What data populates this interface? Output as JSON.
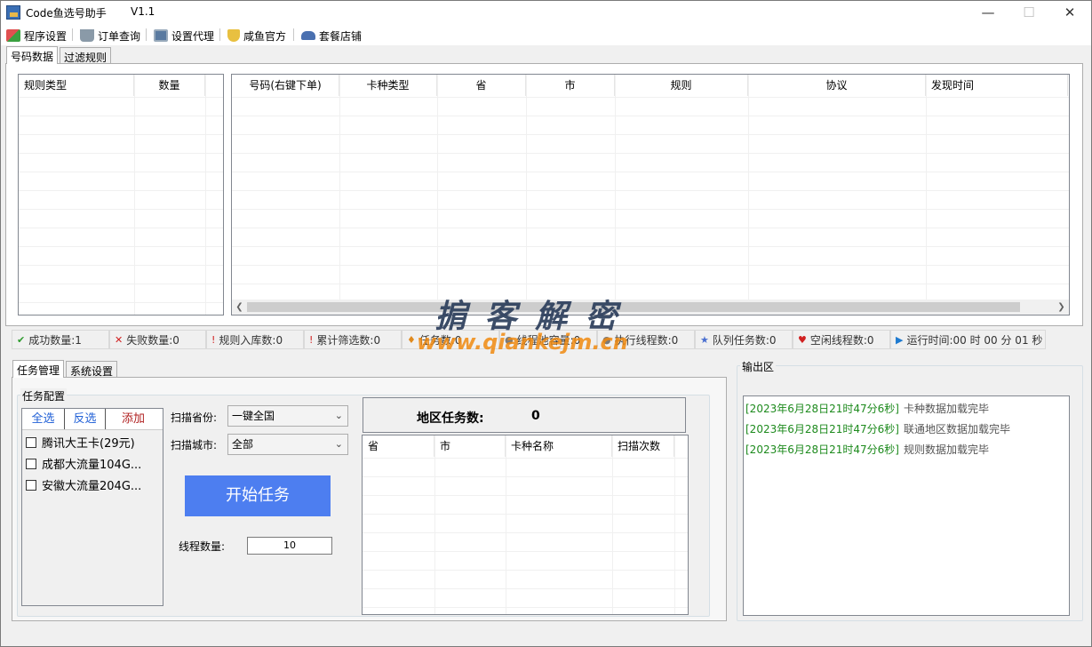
{
  "window": {
    "title": "Code鱼选号助手",
    "version": "V1.1",
    "minimize": "—",
    "maximize": "☐",
    "close": "✕"
  },
  "menu": [
    {
      "label": "程序设置",
      "icon": "settings-icon"
    },
    {
      "label": "订单查询",
      "icon": "cart-icon"
    },
    {
      "label": "设置代理",
      "icon": "computer-icon"
    },
    {
      "label": "咸鱼官方",
      "icon": "shield-icon"
    },
    {
      "label": "套餐店铺",
      "icon": "car-icon"
    }
  ],
  "top_tabs": [
    "号码数据",
    "过滤规则"
  ],
  "rule_table": {
    "columns": [
      "规则类型",
      "数量"
    ]
  },
  "number_table": {
    "columns": [
      "号码(右键下单)",
      "卡种类型",
      "省",
      "市",
      "规则",
      "协议",
      "发现时间"
    ]
  },
  "status_bar": [
    {
      "icon": "✔",
      "color": "#2e9b2e",
      "text": "成功数量:1"
    },
    {
      "icon": "✕",
      "color": "#d02020",
      "text": "失败数量:0"
    },
    {
      "icon": "!",
      "color": "#d02020",
      "text": "规则入库数:0"
    },
    {
      "icon": "!",
      "color": "#d02020",
      "text": "累计筛选数:0"
    },
    {
      "icon": "♦",
      "color": "#e08a1e",
      "text": "任务数:0"
    },
    {
      "icon": "●",
      "color": "#7a7a7a",
      "text": "线程池容量:0"
    },
    {
      "icon": "●",
      "color": "#7a7a7a",
      "text": "执行线程数:0"
    },
    {
      "icon": "★",
      "color": "#4a6fd0",
      "text": "队列任务数:0"
    },
    {
      "icon": "♥",
      "color": "#d02020",
      "text": "空闲线程数:0"
    },
    {
      "icon": "▶",
      "color": "#1e7ad0",
      "text": "运行时间:00 时 00 分 01 秒"
    }
  ],
  "bottom_tabs": [
    "任务管理",
    "系统设置"
  ],
  "task_config": {
    "group_label": "任务配置",
    "select_all": "全选",
    "invert": "反选",
    "add": "添加",
    "cards": [
      "腾讯大王卡(29元)",
      "成都大流量104G...",
      "安徽大流量204G..."
    ],
    "province_label": "扫描省份:",
    "province_value": "一键全国",
    "city_label": "扫描城市:",
    "city_value": "全部",
    "start_button": "开始任务",
    "thread_label": "线程数量:",
    "thread_value": "10",
    "region_task_label": "地区任务数:",
    "region_task_value": "0",
    "region_columns": [
      "省",
      "市",
      "卡种名称",
      "扫描次数"
    ]
  },
  "output": {
    "label": "输出区",
    "logs": [
      {
        "time": "[2023年6月28日21时47分6秒]",
        "msg": "卡种数据加载完毕"
      },
      {
        "time": "[2023年6月28日21时47分6秒]",
        "msg": "联通地区数据加载完毕"
      },
      {
        "time": "[2023年6月28日21时47分6秒]",
        "msg": "规则数据加载完毕"
      }
    ]
  },
  "watermark": {
    "line1": "掮 客 解 密",
    "line2": "www.qiankejm.cn"
  },
  "colors": {
    "accent": "#4d7ef0",
    "log_time": "#1d8a1d",
    "add_text": "#b02020",
    "link_text": "#1f5fd6"
  }
}
